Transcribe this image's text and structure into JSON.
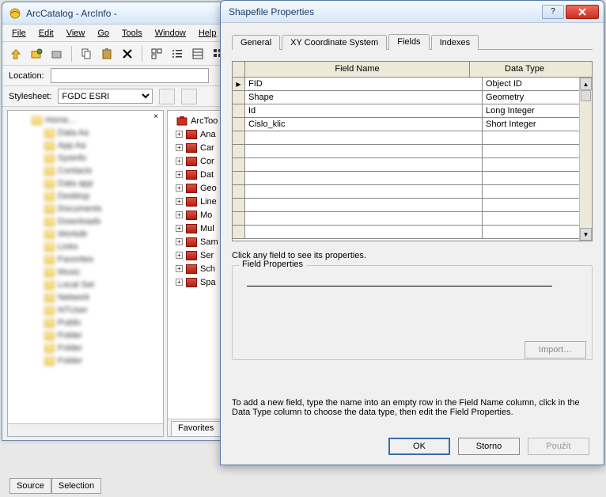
{
  "main_window": {
    "title": "ArcCatalog - ArcInfo -",
    "menus": [
      "File",
      "Edit",
      "View",
      "Go",
      "Tools",
      "Window",
      "Help"
    ],
    "location_label": "Location:",
    "location_value": "",
    "stylesheet_label": "Stylesheet:",
    "stylesheet_value": "FGDC ESRI"
  },
  "toolbar_icons": [
    "up-icon",
    "connect-icon",
    "disconnect-icon",
    "copy-icon",
    "paste-icon",
    "delete-icon",
    "large-icons-icon",
    "list-icon",
    "details-icon",
    "thumbnails-icon"
  ],
  "toolbox": {
    "root": "ArcToo",
    "items": [
      "Ana",
      "Car",
      "Cor",
      "Dat",
      "Geo",
      "Line",
      "Mo",
      "Mul",
      "Sam",
      "Ser",
      "Sch",
      "Spa"
    ]
  },
  "right_tabs": [
    "Favorites"
  ],
  "bottom_tabs": [
    "Source",
    "Selection"
  ],
  "dialog": {
    "title": "Shapefile Properties",
    "tabs": [
      "General",
      "XY Coordinate System",
      "Fields",
      "Indexes"
    ],
    "active_tab": "Fields",
    "columns": [
      "Field Name",
      "Data Type"
    ],
    "rows": [
      {
        "name": "FID",
        "type": "Object ID",
        "selected": true
      },
      {
        "name": "Shape",
        "type": "Geometry"
      },
      {
        "name": "Id",
        "type": "Long Integer"
      },
      {
        "name": "Cislo_klic",
        "type": "Short Integer"
      },
      {
        "name": "",
        "type": ""
      },
      {
        "name": "",
        "type": ""
      },
      {
        "name": "",
        "type": ""
      },
      {
        "name": "",
        "type": ""
      },
      {
        "name": "",
        "type": ""
      },
      {
        "name": "",
        "type": ""
      },
      {
        "name": "",
        "type": ""
      },
      {
        "name": "",
        "type": ""
      }
    ],
    "hint1": "Click any field to see its properties.",
    "fieldprops_legend": "Field Properties",
    "import_label": "Import…",
    "hint2": "To add a new field, type the name into an empty row in the Field Name column, click in the Data Type column to choose the data type, then edit the Field Properties.",
    "buttons": {
      "ok": "OK",
      "cancel": "Storno",
      "apply": "Použít"
    },
    "help_icon": "?"
  }
}
